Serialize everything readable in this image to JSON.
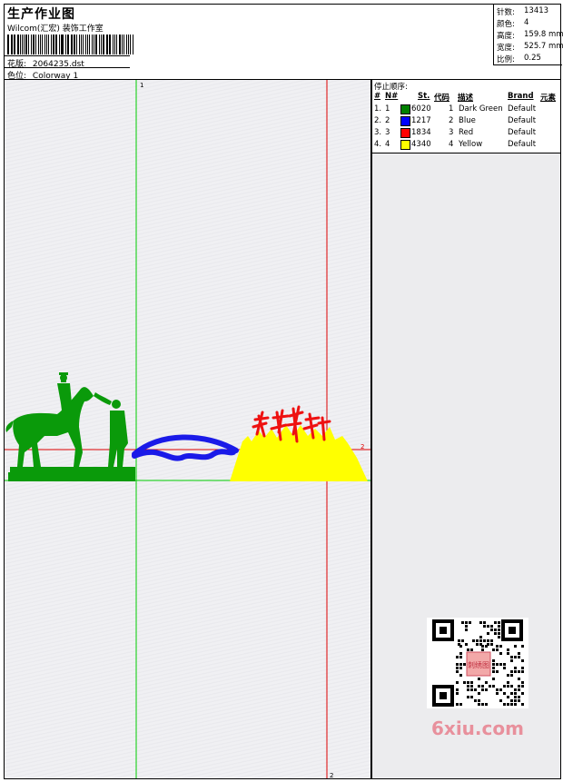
{
  "header": {
    "title": "生产作业图",
    "company": "Wilcom(汇宏) 装饰工作室",
    "design_label": "花版:",
    "design_file": "2064235.dst",
    "colorway_label": "色位:",
    "colorway": "Colorway 1"
  },
  "stats": [
    {
      "label": "针数:",
      "value": "13413"
    },
    {
      "label": "颜色:",
      "value": "4"
    },
    {
      "label": "高度:",
      "value": "159.8 mm"
    },
    {
      "label": "宽度:",
      "value": "525.7 mm"
    },
    {
      "label": "比例:",
      "value": "0.25"
    }
  ],
  "stop_sequence": {
    "title": "停止顺序:",
    "headers": {
      "index": "#",
      "n": "N#",
      "st": "St.",
      "code": "代码",
      "desc": "描述",
      "brand": "Brand",
      "element": "元素"
    },
    "rows": [
      {
        "index": "1.",
        "n": "1",
        "st": "6020",
        "code": "1",
        "desc": "Dark Green",
        "brand": "Default",
        "color": "#008000"
      },
      {
        "index": "2.",
        "n": "2",
        "st": "1217",
        "code": "2",
        "desc": "Blue",
        "brand": "Default",
        "color": "#0000ff"
      },
      {
        "index": "3.",
        "n": "3",
        "st": "1834",
        "code": "3",
        "desc": "Red",
        "brand": "Default",
        "color": "#ff0000"
      },
      {
        "index": "4.",
        "n": "4",
        "st": "4340",
        "code": "4",
        "desc": "Yellow",
        "brand": "Default",
        "color": "#ffff00"
      }
    ]
  },
  "canvas": {
    "marker_v1": "1",
    "marker_h": "2",
    "marker_v2": "2",
    "axis_colors": {
      "green": "#00cc00",
      "red": "#dd0000"
    }
  },
  "watermark": {
    "text": "6xiu.com",
    "stamp": "刺绣图"
  }
}
